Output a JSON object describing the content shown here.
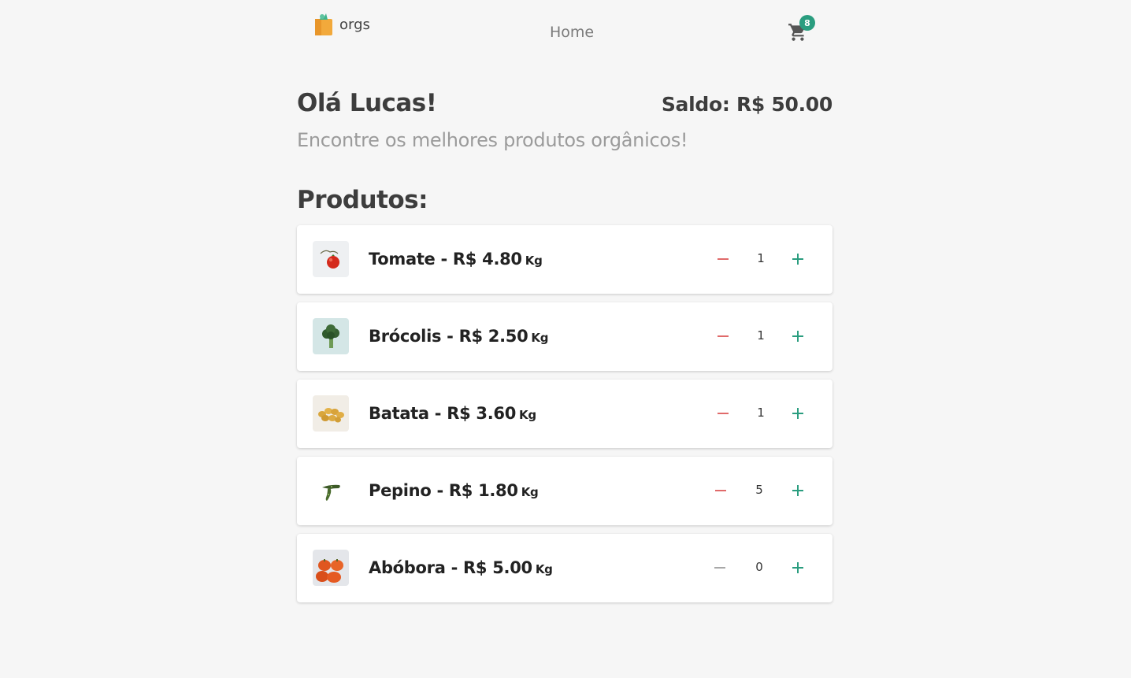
{
  "header": {
    "logo_text": "orgs",
    "nav_home": "Home",
    "cart_count": "8"
  },
  "greeting": "Olá Lucas!",
  "balance": "Saldo: R$ 50.00",
  "subtitle": "Encontre os melhores produtos orgânicos!",
  "section_title": "Produtos:",
  "colors": {
    "accent": "#2a9d7f",
    "minus_active": "#e06a6a",
    "minus_disabled": "#a8a8a8"
  },
  "products": [
    {
      "name": "Tomate - R$ 4.80",
      "unit": "Kg",
      "quantity": "1",
      "icon": "tomato-image",
      "minus_enabled": true
    },
    {
      "name": "Brócolis - R$ 2.50",
      "unit": "Kg",
      "quantity": "1",
      "icon": "broccoli-image",
      "minus_enabled": true
    },
    {
      "name": "Batata - R$ 3.60",
      "unit": "Kg",
      "quantity": "1",
      "icon": "potato-image",
      "minus_enabled": true
    },
    {
      "name": "Pepino - R$ 1.80",
      "unit": "Kg",
      "quantity": "5",
      "icon": "cucumber-image",
      "minus_enabled": true
    },
    {
      "name": "Abóbora - R$ 5.00",
      "unit": "Kg",
      "quantity": "0",
      "icon": "pumpkin-image",
      "minus_enabled": false
    }
  ]
}
